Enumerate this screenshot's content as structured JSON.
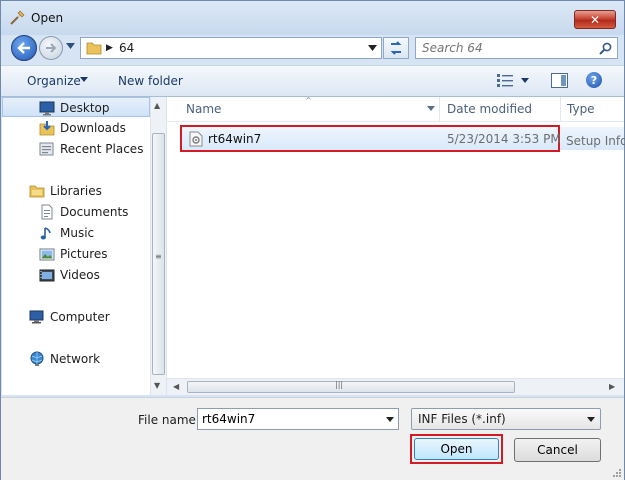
{
  "window": {
    "title": "Open",
    "close_label": "✕"
  },
  "nav": {
    "address_segment": "64",
    "search_placeholder": "Search 64"
  },
  "toolbar": {
    "organize_label": "Organize",
    "new_folder_label": "New folder",
    "help_label": "?"
  },
  "sidebar": {
    "items": [
      {
        "label": "Desktop",
        "icon": "desktop-icon"
      },
      {
        "label": "Downloads",
        "icon": "downloads-icon"
      },
      {
        "label": "Recent Places",
        "icon": "recent-places-icon"
      },
      {
        "label": "Libraries",
        "icon": "libraries-icon"
      },
      {
        "label": "Documents",
        "icon": "documents-icon"
      },
      {
        "label": "Music",
        "icon": "music-icon"
      },
      {
        "label": "Pictures",
        "icon": "pictures-icon"
      },
      {
        "label": "Videos",
        "icon": "videos-icon"
      },
      {
        "label": "Computer",
        "icon": "computer-icon"
      },
      {
        "label": "Network",
        "icon": "network-icon"
      }
    ],
    "selected": "Desktop"
  },
  "filelist": {
    "columns": [
      "Name",
      "Date modified",
      "Type"
    ],
    "rows": [
      {
        "name": "rt64win7",
        "date": "5/23/2014 3:53 PM",
        "type": "Setup Infor"
      }
    ]
  },
  "bottom": {
    "file_name_label": "File name:",
    "file_name_value": "rt64win7",
    "file_type_value": "INF Files (*.inf)",
    "open_label": "Open",
    "cancel_label": "Cancel"
  },
  "colors": {
    "highlight_border": "#d21b24",
    "selection_fill": "#d9e9fb",
    "title_bar": "#c7d9ee"
  }
}
